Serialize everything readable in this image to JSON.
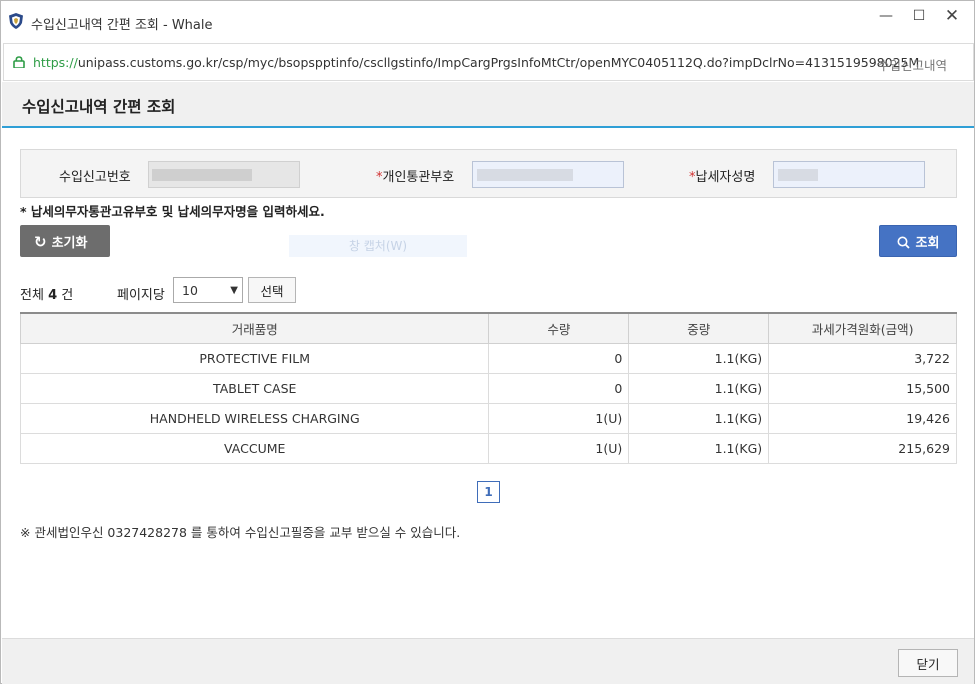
{
  "window": {
    "title": "수입신고내역 간편 조회 - Whale",
    "minimize": "—",
    "maximize": "☐",
    "close": "✕"
  },
  "address_bar": {
    "scheme": "https://",
    "url_rest": "unipass.customs.go.kr/csp/myc/bsopspptinfo/cscllgstinfo/ImpCargPrgsInfoMtCtr/openMYC0405112Q.do?impDclrNo=4131519598025M",
    "page_title": "수입신고내역"
  },
  "header": {
    "title": "수입신고내역 간편 조회"
  },
  "search": {
    "declaration_no_label": "수입신고번호",
    "customs_code_label": "개인통관부호",
    "taxpayer_name_label": "납세자성명",
    "required_mark": "*",
    "hint": "* 납세의무자통관고유부호 및 납세의무자명을 입력하세요.",
    "reset_label": "초기화",
    "search_label": "조회",
    "ghost_text": "창 캡처(W)"
  },
  "list": {
    "total_prefix": "전체 ",
    "total_count": "4",
    "total_suffix": " 건",
    "per_page_label": "페이지당",
    "per_page_value": "10",
    "select_label": "선택",
    "columns": [
      "거래품명",
      "수량",
      "중량",
      "과세가격원화(금액)"
    ],
    "rows": [
      {
        "name": "PROTECTIVE FILM",
        "qty": "0",
        "weight": "1.1(KG)",
        "price": "3,722"
      },
      {
        "name": "TABLET CASE",
        "qty": "0",
        "weight": "1.1(KG)",
        "price": "15,500"
      },
      {
        "name": "HANDHELD WIRELESS CHARGING",
        "qty": "1(U)",
        "weight": "1.1(KG)",
        "price": "19,426"
      },
      {
        "name": "VACCUME",
        "qty": "1(U)",
        "weight": "1.1(KG)",
        "price": "215,629"
      }
    ]
  },
  "pagination": {
    "current": "1"
  },
  "notice": "※ 관세법인우신 0327428278 를 통하여 수입신고필증을 교부 받으실 수 있습니다.",
  "footer": {
    "close_label": "닫기"
  },
  "colors": {
    "accent": "#2f9fd6",
    "search_button": "#4573c4",
    "reset_button": "#6d6d6d",
    "required": "#d03030"
  }
}
